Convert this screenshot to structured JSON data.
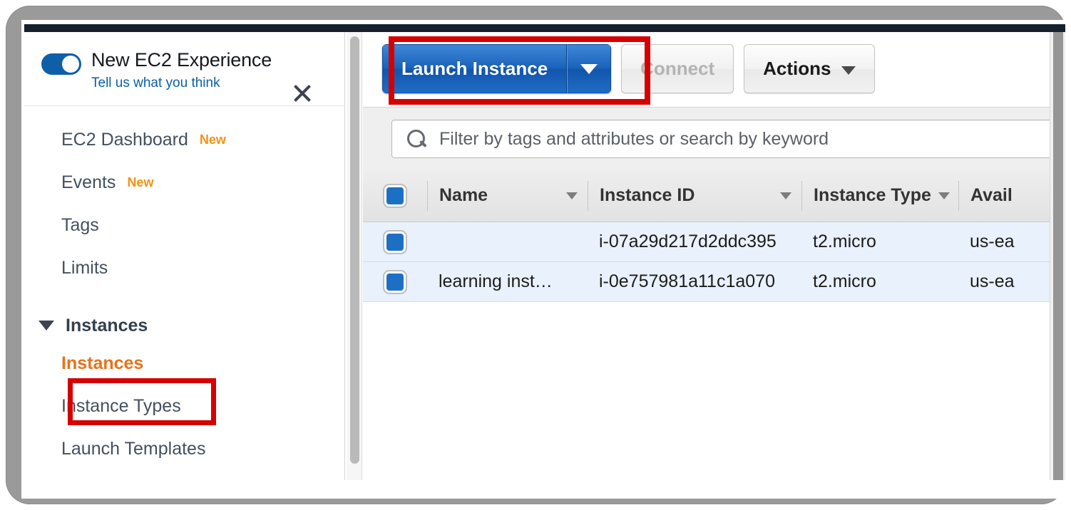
{
  "window": {
    "topbar_color": "#16212e",
    "frame_color": "#9a9a9a"
  },
  "sidebar": {
    "experience_banner": {
      "toggle_state": "on",
      "toggle_color": "#0f5fa8",
      "title": "New EC2 Experience",
      "feedback_link": "Tell us what you think",
      "close_icon": "close-icon"
    },
    "items": [
      {
        "label": "EC2 Dashboard",
        "badge": "New",
        "type": "link",
        "active": false
      },
      {
        "label": "Events",
        "badge": "New",
        "type": "link",
        "active": false
      },
      {
        "label": "Tags",
        "badge": "",
        "type": "link",
        "active": false
      },
      {
        "label": "Limits",
        "badge": "",
        "type": "link",
        "active": false
      }
    ],
    "group": {
      "label": "Instances",
      "expanded": true,
      "caret_icon": "caret-down-icon",
      "children": [
        {
          "label": "Instances",
          "active": true,
          "highlighted": true
        },
        {
          "label": "Instance Types",
          "active": false,
          "highlighted": false
        },
        {
          "label": "Launch Templates",
          "active": false,
          "highlighted": false
        }
      ]
    },
    "badge_color": "#f59113",
    "active_color": "#e8721b"
  },
  "toolbar": {
    "launch_label": "Launch Instance",
    "launch_caret_icon": "caret-down-icon",
    "launch_highlighted": true,
    "connect_label": "Connect",
    "connect_disabled": true,
    "actions_label": "Actions",
    "actions_caret_icon": "chevron-down-icon",
    "highlight_color": "#d50000",
    "primary_color": "#1a63bd"
  },
  "filter": {
    "search_icon": "search-icon",
    "placeholder": "Filter by tags and attributes or search by keyword",
    "value": ""
  },
  "table": {
    "select_all_checked": true,
    "columns": [
      {
        "label": "Name",
        "sortable": true
      },
      {
        "label": "Instance ID",
        "sortable": true
      },
      {
        "label": "Instance Type",
        "sortable": true
      },
      {
        "label": "Avail",
        "sortable": false,
        "truncated": true
      }
    ],
    "rows": [
      {
        "checked": true,
        "name": "",
        "instance_id": "i-07a29d217d2ddc395",
        "instance_type": "t2.micro",
        "availability_zone": "us-ea"
      },
      {
        "checked": true,
        "name": "learning inst…",
        "instance_id": "i-0e757981a11c1a070",
        "instance_type": "t2.micro",
        "availability_zone": "us-ea"
      }
    ]
  }
}
